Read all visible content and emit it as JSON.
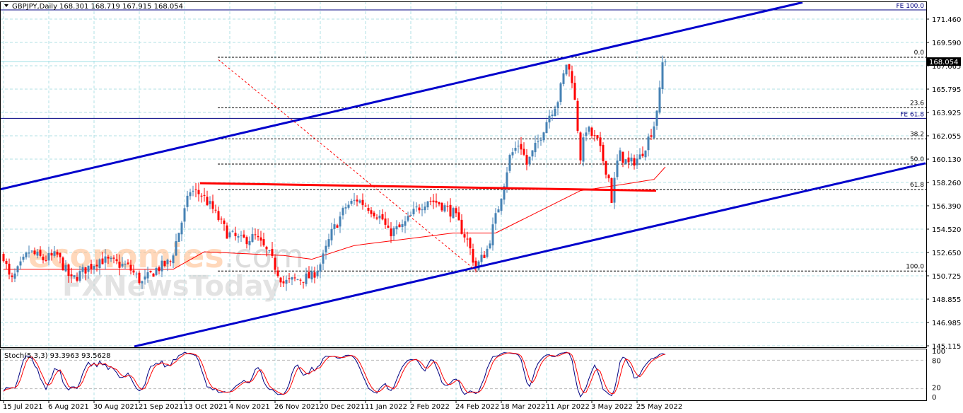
{
  "header": {
    "symbol": "GBPJPY,Daily",
    "ohlc": "168.301 168.719 167.915 168.054"
  },
  "watermark": {
    "brand_top": "economies.com",
    "brand_bottom": "FXNewsToday"
  },
  "colors": {
    "bull": "#4682b4",
    "bear": "#ff0000",
    "channel": "#0000cc",
    "fe_line": "#000080",
    "grid": "#b0e0e6",
    "ma": "#ff0000",
    "stoch_main": "#000080",
    "stoch_signal": "#ff0000"
  },
  "chart_data": {
    "type": "candlestick",
    "title": "GBPJPY,Daily",
    "current_price": "168.054",
    "price_ticks": [
      "171.460",
      "169.590",
      "167.665",
      "165.795",
      "163.925",
      "162.055",
      "160.130",
      "158.260",
      "156.390",
      "154.520",
      "152.650",
      "150.725",
      "148.855",
      "146.985",
      "145.115"
    ],
    "ylim": [
      145.115,
      171.46
    ],
    "bar_count": 235,
    "close_waypoints": [
      [
        0,
        152.5
      ],
      [
        2.5,
        150.3
      ],
      [
        9,
        152.8
      ],
      [
        14,
        152.2
      ],
      [
        19,
        152.5
      ],
      [
        24,
        150.5
      ],
      [
        29,
        151.4
      ],
      [
        34,
        152.2
      ],
      [
        39,
        151.9
      ],
      [
        44,
        151.6
      ],
      [
        49,
        150.3
      ],
      [
        54,
        151.4
      ],
      [
        59,
        152
      ],
      [
        62.5,
        154.8
      ],
      [
        66,
        157.7
      ],
      [
        70,
        157.4
      ],
      [
        74,
        156.2
      ],
      [
        79,
        154.3
      ],
      [
        84,
        153.7
      ],
      [
        89,
        154
      ],
      [
        94,
        152.5
      ],
      [
        99,
        150.3
      ],
      [
        104,
        150.6
      ],
      [
        109,
        150.8
      ],
      [
        112.5,
        152
      ],
      [
        116,
        154.3
      ],
      [
        121,
        156.4
      ],
      [
        125,
        157
      ],
      [
        129,
        156.4
      ],
      [
        134,
        155.4
      ],
      [
        136,
        154.3
      ],
      [
        141,
        154.8
      ],
      [
        146,
        156.2
      ],
      [
        150,
        157
      ],
      [
        154,
        156.7
      ],
      [
        159,
        155.9
      ],
      [
        164,
        153.7
      ],
      [
        167,
        151.5
      ],
      [
        171,
        153
      ],
      [
        175,
        156.4
      ],
      [
        179,
        160.4
      ],
      [
        182.5,
        161.6
      ],
      [
        185,
        159.8
      ],
      [
        189,
        161.6
      ],
      [
        192.5,
        163.6
      ],
      [
        196,
        165
      ],
      [
        199,
        167.9
      ],
      [
        201,
        166.7
      ],
      [
        202.5,
        163.9
      ],
      [
        204,
        160.4
      ],
      [
        206,
        162.7
      ],
      [
        210,
        161.6
      ],
      [
        214,
        158.7
      ],
      [
        215,
        157
      ],
      [
        217.5,
        160.7
      ],
      [
        221,
        159.8
      ],
      [
        225,
        160.4
      ],
      [
        227.5,
        161.6
      ],
      [
        230,
        163
      ],
      [
        232,
        165.6
      ],
      [
        233,
        167.9
      ],
      [
        234,
        168.054
      ]
    ],
    "ma_waypoints": [
      [
        0,
        151.4
      ],
      [
        60,
        151.4
      ],
      [
        71,
        152.8
      ],
      [
        99,
        152.5
      ],
      [
        109,
        152.2
      ],
      [
        124,
        153.3
      ],
      [
        159,
        154.3
      ],
      [
        174,
        154.3
      ],
      [
        189,
        156
      ],
      [
        204,
        157.7
      ],
      [
        219,
        158.2
      ],
      [
        230,
        158.6
      ],
      [
        234,
        159.6
      ]
    ],
    "x_tick_labels": [
      "15 Jul 2021",
      "6 Aug 2021",
      "30 Aug 2021",
      "21 Sep 2021",
      "13 Oct 2021",
      "4 Nov 2021",
      "26 Nov 2021",
      "20 Dec 2021",
      "11 Jan 2022",
      "2 Feb 2022",
      "24 Feb 2022",
      "18 Mar 2022",
      "11 Apr 2022",
      "3 May 2022",
      "25 May 2022"
    ],
    "channel_upper": [
      [
        -1.25,
        157.8
      ],
      [
        282.5,
        172.8
      ]
    ],
    "channel_lower": [
      [
        46.25,
        145.2
      ],
      [
        326,
        159.9
      ]
    ],
    "support_line": [
      [
        69.5,
        158.3
      ],
      [
        230.75,
        157.7
      ]
    ],
    "fib_diagonal": [
      [
        76,
        168.2
      ],
      [
        167,
        151.3
      ]
    ],
    "fib_levels": [
      {
        "label": "0.0",
        "price": 168.4
      },
      {
        "label": "23.6",
        "price": 164.35
      },
      {
        "label": "38.2",
        "price": 161.85
      },
      {
        "label": "50.0",
        "price": 159.83
      },
      {
        "label": "61.8",
        "price": 157.8
      },
      {
        "label": "100.0",
        "price": 151.25
      }
    ],
    "fe_levels": [
      {
        "label": "FE 100.0",
        "price": 172.2
      },
      {
        "label": "FE 61.8",
        "price": 163.5
      }
    ],
    "stochastic": {
      "label": "Stoch(5,3,3) 93.3963 93.5628",
      "k_period": 5,
      "d_period": 3,
      "slowing": 3,
      "ticks": [
        "100",
        "80",
        "20",
        "0"
      ]
    }
  }
}
